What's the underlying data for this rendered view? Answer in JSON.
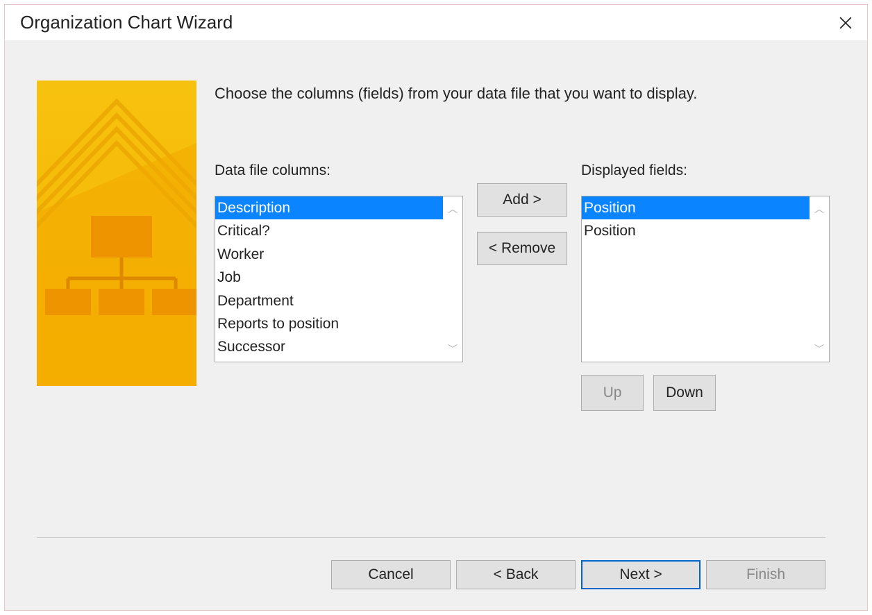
{
  "title": "Organization Chart Wizard",
  "instruction": "Choose the columns (fields) from your data file that you want to display.",
  "labels": {
    "data_file_columns": "Data file columns:",
    "displayed_fields": "Displayed fields:"
  },
  "data_columns": [
    "Description",
    "Critical?",
    "Worker",
    "Job",
    "Department",
    "Reports to position",
    "Successor"
  ],
  "displayed_fields": [
    "Position",
    "Position"
  ],
  "selected_data_index": 0,
  "selected_display_index": 0,
  "buttons": {
    "add": "Add >",
    "remove": "< Remove",
    "up": "Up",
    "down": "Down",
    "cancel": "Cancel",
    "back": "< Back",
    "next": "Next >",
    "finish": "Finish"
  }
}
